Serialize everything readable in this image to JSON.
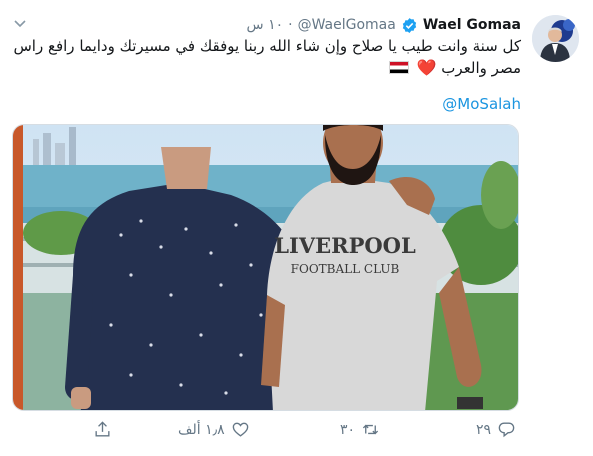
{
  "tweet": {
    "display_name": "Wael Gomaa",
    "handle": "@WaelGomaa",
    "separator": "·",
    "time": "١٠ س",
    "text_line1": "كل سنة وانت طيب يا صلاح وإن شاء الله ربنا يوفقك في مسيرتك ودايما رافع راس",
    "text_line2": "مصر والعرب",
    "heart": "❤️",
    "mention": "@MoSalah",
    "verified": true
  },
  "icons": {
    "verified": "verified-badge-icon",
    "caret": "chevron-down-icon",
    "reply": "reply-icon",
    "retweet": "retweet-icon",
    "like": "like-icon",
    "share": "share-icon"
  },
  "actions": {
    "reply_count": "٢٩",
    "retweet_count": "٣٠",
    "like_count": "١٫٨ ألف"
  },
  "photo": {
    "shirt_line1": "LIVERPOOL",
    "shirt_line2": "FOOTBALL CLUB"
  },
  "colors": {
    "link": "#1b95e0",
    "verified": "#1da1f2",
    "heart": "#e0245e",
    "muted": "#657786"
  }
}
